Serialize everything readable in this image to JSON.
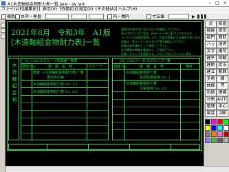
{
  "window": {
    "title": "A1木造軸組金物耐力表一覧.jww - jw_win",
    "min_glyph": "–",
    "max_glyph": "□",
    "close_glyph": "×"
  },
  "menu": [
    "ファイル(F)",
    "[編集(E)]",
    "表示(V)",
    "[作図(D)]",
    "設定(S)",
    "[その他(A)]",
    "ヘルプ(H)"
  ],
  "toolbar": {
    "check1": "複数",
    "check2": "水平・垂直",
    "check3": "円・楕円",
    "check4": "寸法値",
    "icon_glyph": "▶"
  },
  "drawing": {
    "title_line1": "2021年8月　令和3年　A1版",
    "title_line2": "[木造軸組金物耐力表]一覧",
    "left_column_label": "木造軸組金物",
    "section_header": "Jw_CAD のグループ別図面一覧表",
    "right_section_header": "JW_CAD データ のグループ一覧",
    "columns_left": [
      "図面 No.",
      "図　面　名　称",
      "グループ"
    ],
    "columns_right": [
      "図面 No.",
      "図　面　名　称",
      "備考"
    ],
    "rows_left": [
      {
        "text": "表紙　(木造軸組金物耐力表)一覧",
        "sub": "書誌目次等"
      },
      {
        "text": "木造軸組金物耐力表 No. 1/2",
        "sub": ""
      },
      {
        "text": "木造軸組金物耐力表 No. 2/2",
        "sub": ""
      }
    ],
    "rows_right": [
      {
        "text": "木造軸組金物耐力表",
        "sub": "柱頭柱脚金物 No. 1"
      },
      {
        "text": "木造軸組金物耐力表",
        "sub": "引寄金物 No. 1/2"
      }
    ],
    "notes": [
      "図面を作成するに当たり以下を確認して下さい。",
      "表示されている寸法は、JWW データに基づいております。",
      "メーカーの仕様変更等により、内容が変更になる場合があります。",
      "詳細は、各メーカーのカタログ等を確認して下さい。",
      "本表は参考資料として使用して下さい。",
      "必ず最新の情報を確認の上、ご使用下さい。",
      "注意：グループを変更する、グループの[ファイル]一覧を..."
    ]
  },
  "right_panel": {
    "buttons_left": [
      "点",
      "接線",
      "接円",
      "ハッチ",
      "文字",
      "建平",
      "建断",
      "建立",
      "多角形",
      "曲線",
      "包絡",
      "分割",
      "整理",
      "属変",
      "BL化",
      "BL解",
      "BL属",
      "BL編",
      "BL終",
      "図形",
      "図登"
    ],
    "buttons_right": [
      "鉛直",
      "矩形",
      "面取",
      "消去",
      "複写",
      "移動",
      "戻る",
      "範囲",
      "線",
      "円",
      "連線",
      "AUTO",
      "中心線",
      "2線",
      "複線",
      "コーナー",
      "伸縮",
      "寸法",
      "2.5D",
      "測定",
      "表計"
    ],
    "colors": [
      "#000000",
      "#ff00ff",
      "#ff0000",
      "#00ff00",
      "#ffff00",
      "#0000ff",
      "#00ffff",
      "#ffffff",
      "#808080",
      "#ff8000",
      "#ff66cc",
      "#cc0000",
      "#8080ff",
      "#40c040",
      "#606060",
      "#b0b0b0"
    ]
  }
}
